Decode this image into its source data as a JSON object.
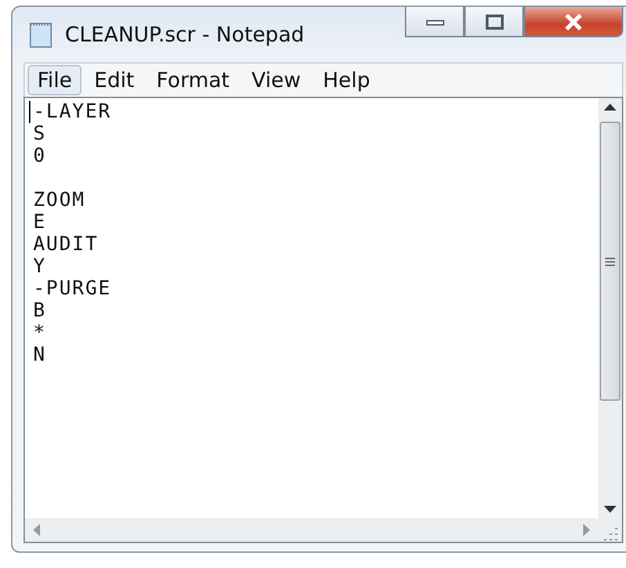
{
  "window": {
    "title": "CLEANUP.scr - Notepad"
  },
  "menu": [
    {
      "label": "File",
      "selected": true
    },
    {
      "label": "Edit",
      "selected": false
    },
    {
      "label": "Format",
      "selected": false
    },
    {
      "label": "View",
      "selected": false
    },
    {
      "label": "Help",
      "selected": false
    }
  ],
  "editor": {
    "blocks": [
      [
        "-LAYER",
        "S",
        "0"
      ],
      [
        "ZOOM",
        "E",
        "AUDIT",
        "Y",
        "-PURGE",
        "B",
        "*",
        "N"
      ]
    ]
  }
}
